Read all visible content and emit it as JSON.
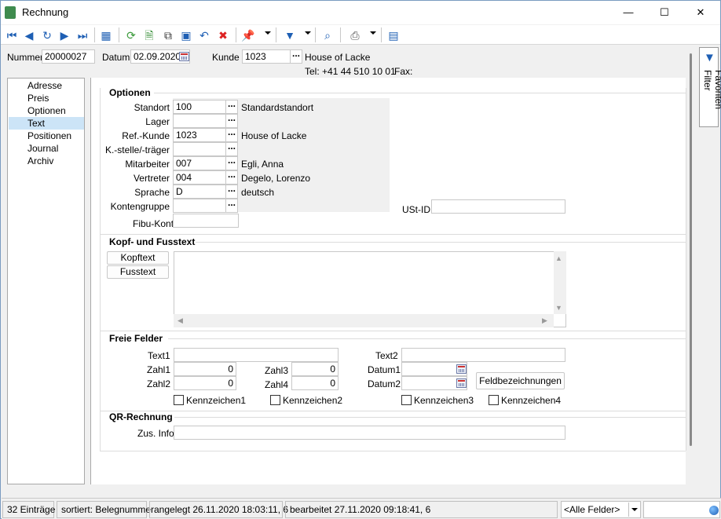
{
  "window": {
    "title": "Rechnung",
    "minimize": "—",
    "maximize": "☐",
    "close": "✕"
  },
  "header": {
    "nummer_label": "Nummer",
    "nummer_value": "20000027",
    "datum_label": "Datum",
    "datum_value": "02.09.2020",
    "kunde_label": "Kunde",
    "kunde_value": "1023",
    "kunde_name": "House of Lacke",
    "tel": "Tel: +41 44 510 10 01",
    "fax": "Fax:"
  },
  "nav": {
    "items": [
      "Adresse",
      "Preis",
      "Optionen",
      "Text",
      "Positionen",
      "Journal",
      "Archiv"
    ],
    "selected": "Text"
  },
  "optionen": {
    "title": "Optionen",
    "rows": [
      {
        "label": "Standort",
        "value": "100",
        "desc": "Standardstandort"
      },
      {
        "label": "Lager",
        "value": "",
        "desc": ""
      },
      {
        "label": "Ref.-Kunde",
        "value": "1023",
        "desc": "House of Lacke"
      },
      {
        "label": "K.-stelle/-träger",
        "value": "",
        "desc": ""
      },
      {
        "label": "Mitarbeiter",
        "value": "007",
        "desc": "Egli, Anna"
      },
      {
        "label": "Vertreter",
        "value": "004",
        "desc": "Degelo, Lorenzo"
      },
      {
        "label": "Sprache",
        "value": "D",
        "desc": "deutsch"
      },
      {
        "label": "Kontengruppe",
        "value": "",
        "desc": ""
      }
    ],
    "fibu_label": "Fibu-Konto",
    "fibu_value": "",
    "ustid_label": "USt-ID",
    "ustid_value": ""
  },
  "kopf": {
    "title": "Kopf- und Fusstext",
    "kopftext_btn": "Kopftext",
    "fusstext_btn": "Fusstext",
    "text_value": ""
  },
  "freie": {
    "title": "Freie Felder",
    "text1_label": "Text1",
    "text1_value": "",
    "text2_label": "Text2",
    "text2_value": "",
    "zahl1_label": "Zahl1",
    "zahl1_value": "0",
    "zahl2_label": "Zahl2",
    "zahl2_value": "0",
    "zahl3_label": "Zahl3",
    "zahl3_value": "0",
    "zahl4_label": "Zahl4",
    "zahl4_value": "0",
    "datum1_label": "Datum1",
    "datum1_value": "",
    "datum2_label": "Datum2",
    "datum2_value": "",
    "feld_btn": "Feldbezeichnungen",
    "checks": [
      "Kennzeichen1",
      "Kennzeichen2",
      "Kennzeichen3",
      "Kennzeichen4"
    ]
  },
  "qr": {
    "title": "QR-Rechnung",
    "zus_label": "Zus. Info",
    "zus_value": ""
  },
  "side": {
    "favoriten": "Favoriten Filter"
  },
  "status": {
    "entries": "32 Einträge",
    "sorted": "sortiert: Belegnummer",
    "created": "angelegt 26.11.2020 18:03:11,  6",
    "edited": "bearbeitet 27.11.2020 09:18:41,  6",
    "field_select": "<Alle Felder>",
    "search_value": ""
  },
  "colors": {
    "accent_blue": "#1e5fb4",
    "selection": "#cce4f7"
  }
}
